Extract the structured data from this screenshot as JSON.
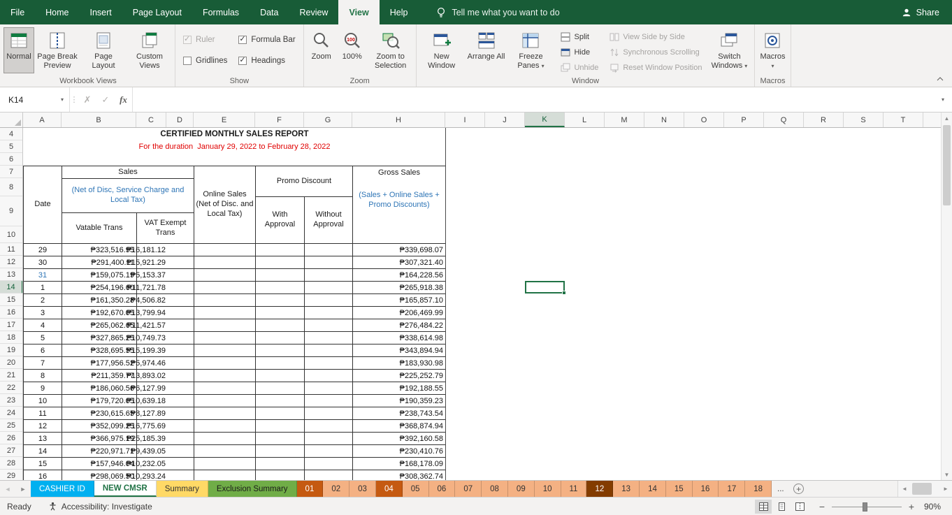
{
  "top_tabs": {
    "items": [
      "File",
      "Home",
      "Insert",
      "Page Layout",
      "Formulas",
      "Data",
      "Review",
      "View",
      "Help"
    ],
    "active": "View",
    "search_label": "Tell me what you want to do",
    "share_label": "Share"
  },
  "ribbon": {
    "workbook_views": {
      "group_label": "Workbook Views",
      "normal": "Normal",
      "page_break_preview": "Page Break Preview",
      "page_layout": "Page Layout",
      "custom_views": "Custom Views",
      "selected": "Normal"
    },
    "show": {
      "group_label": "Show",
      "checkboxes": [
        {
          "label": "Ruler",
          "checked": true,
          "disabled": true
        },
        {
          "label": "Gridlines",
          "checked": false,
          "disabled": false
        },
        {
          "label": "Formula Bar",
          "checked": true,
          "disabled": false
        },
        {
          "label": "Headings",
          "checked": true,
          "disabled": false
        }
      ]
    },
    "zoom": {
      "group_label": "Zoom",
      "zoom": "Zoom",
      "hundred": "100%",
      "zoom_to_selection": "Zoom to Selection"
    },
    "window": {
      "group_label": "Window",
      "large": [
        {
          "label": "New Window"
        },
        {
          "label": "Arrange All"
        },
        {
          "label": "Freeze Panes",
          "dropdown": true
        }
      ],
      "small1": [
        {
          "label": "Split",
          "disabled": false
        },
        {
          "label": "Hide",
          "disabled": false
        },
        {
          "label": "Unhide",
          "disabled": true
        }
      ],
      "small2": [
        {
          "label": "View Side by Side",
          "disabled": true
        },
        {
          "label": "Synchronous Scrolling",
          "disabled": true
        },
        {
          "label": "Reset Window Position",
          "disabled": true
        }
      ],
      "switch_windows": "Switch Windows"
    },
    "macros": {
      "group_label": "Macros",
      "macros": "Macros"
    }
  },
  "formula_bar": {
    "name_box": "K14",
    "fx_label": "fx",
    "formula": ""
  },
  "grid": {
    "columns": [
      "A",
      "B",
      "C",
      "D",
      "E",
      "F",
      "G",
      "H",
      "I",
      "J",
      "K",
      "L",
      "M",
      "N",
      "O",
      "P",
      "Q",
      "R",
      "S",
      "T"
    ],
    "rows": [
      4,
      5,
      6,
      7,
      8,
      9,
      10,
      11,
      12,
      13,
      14,
      15,
      16,
      17,
      18,
      19,
      20,
      21,
      22,
      23,
      24,
      25,
      26,
      27,
      28,
      29
    ],
    "selected_column": "K",
    "selected_row": 14,
    "active_cell": "K14"
  },
  "sheet": {
    "title": "CERTIFIED MONTHLY SALES REPORT",
    "period": "For the duration  January 29, 2022 to February 28, 2022",
    "header": {
      "date": "Date",
      "sales": "Sales",
      "sales_note": "(Net of Disc, Service Charge and Local Tax)",
      "vatable": "Vatable Trans",
      "vat_exempt": "VAT Exempt Trans",
      "online": "Online Sales (Net of Disc. and Local Tax)",
      "promo": "Promo Discount",
      "with_approval": "With Approval",
      "without_approval": "Without Approval",
      "gross": "Gross Sales",
      "gross_note": "(Sales + Online Sales + Promo Discounts)"
    },
    "rows": [
      {
        "row": 11,
        "date": "29",
        "vatable": "₱323,516.95",
        "vat_exempt": "₱16,181.12",
        "gross": "₱339,698.07"
      },
      {
        "row": 12,
        "date": "30",
        "vatable": "₱291,400.11",
        "vat_exempt": "₱15,921.29",
        "gross": "₱307,321.40"
      },
      {
        "row": 13,
        "date": "31",
        "date_style": "blue",
        "vatable": "₱159,075.19",
        "vat_exempt": "₱5,153.37",
        "gross": "₱164,228.56"
      },
      {
        "row": 14,
        "date": "1",
        "vatable": "₱254,196.60",
        "vat_exempt": "₱11,721.78",
        "gross": "₱265,918.38"
      },
      {
        "row": 15,
        "date": "2",
        "vatable": "₱161,350.28",
        "vat_exempt": "₱4,506.82",
        "gross": "₱165,857.10"
      },
      {
        "row": 16,
        "date": "3",
        "vatable": "₱192,670.05",
        "vat_exempt": "₱13,799.94",
        "gross": "₱206,469.99"
      },
      {
        "row": 17,
        "date": "4",
        "vatable": "₱265,062.65",
        "vat_exempt": "₱11,421.57",
        "gross": "₱276,484.22"
      },
      {
        "row": 18,
        "date": "5",
        "vatable": "₱327,865.25",
        "vat_exempt": "₱10,749.73",
        "gross": "₱338,614.98"
      },
      {
        "row": 19,
        "date": "6",
        "vatable": "₱328,695.55",
        "vat_exempt": "₱15,199.39",
        "gross": "₱343,894.94"
      },
      {
        "row": 20,
        "date": "7",
        "vatable": "₱177,956.52",
        "vat_exempt": "₱5,974.46",
        "gross": "₱183,930.98"
      },
      {
        "row": 21,
        "date": "8",
        "vatable": "₱211,359.77",
        "vat_exempt": "₱13,893.02",
        "gross": "₱225,252.79"
      },
      {
        "row": 22,
        "date": "9",
        "vatable": "₱186,060.56",
        "vat_exempt": "₱6,127.99",
        "gross": "₱192,188.55"
      },
      {
        "row": 23,
        "date": "10",
        "vatable": "₱179,720.05",
        "vat_exempt": "₱10,639.18",
        "gross": "₱190,359.23"
      },
      {
        "row": 24,
        "date": "11",
        "vatable": "₱230,615.65",
        "vat_exempt": "₱8,127.89",
        "gross": "₱238,743.54"
      },
      {
        "row": 25,
        "date": "12",
        "vatable": "₱352,099.25",
        "vat_exempt": "₱16,775.69",
        "gross": "₱368,874.94"
      },
      {
        "row": 26,
        "date": "13",
        "vatable": "₱366,975.19",
        "vat_exempt": "₱25,185.39",
        "gross": "₱392,160.58"
      },
      {
        "row": 27,
        "date": "14",
        "vatable": "₱220,971.71",
        "vat_exempt": "₱9,439.05",
        "gross": "₱230,410.76"
      },
      {
        "row": 28,
        "date": "15",
        "vatable": "₱157,946.04",
        "vat_exempt": "₱10,232.05",
        "gross": "₱168,178.09"
      },
      {
        "row": 29,
        "date": "16",
        "vatable": "₱298,069.50",
        "vat_exempt": "₱10,293.24",
        "gross": "₱308,362.74"
      }
    ]
  },
  "sheet_tabs": {
    "active": "NEW CMSR",
    "overflow_label": "...",
    "tabs": [
      {
        "label": "CASHIER ID",
        "bg": "#00B0F0",
        "fg": "#FFFFFF"
      },
      {
        "label": "NEW CMSR",
        "bg": "#FFFFFF",
        "fg": "#217346",
        "active": true
      },
      {
        "label": "Summary",
        "bg": "#FFD966",
        "fg": "#333333"
      },
      {
        "label": "Exclusion Summary",
        "bg": "#70AD47",
        "fg": "#1A1A1A"
      },
      {
        "label": "01",
        "bg": "#C55A11",
        "fg": "#FFFFFF"
      },
      {
        "label": "02",
        "bg": "#F4B183",
        "fg": "#333333"
      },
      {
        "label": "03",
        "bg": "#F4B183",
        "fg": "#333333"
      },
      {
        "label": "04",
        "bg": "#C55A11",
        "fg": "#FFFFFF"
      },
      {
        "label": "05",
        "bg": "#F4B183",
        "fg": "#333333"
      },
      {
        "label": "06",
        "bg": "#F4B183",
        "fg": "#333333"
      },
      {
        "label": "07",
        "bg": "#F4B183",
        "fg": "#333333"
      },
      {
        "label": "08",
        "bg": "#F4B183",
        "fg": "#333333"
      },
      {
        "label": "09",
        "bg": "#F4B183",
        "fg": "#333333"
      },
      {
        "label": "10",
        "bg": "#F4B183",
        "fg": "#333333"
      },
      {
        "label": "11",
        "bg": "#F4B183",
        "fg": "#333333"
      },
      {
        "label": "12",
        "bg": "#833C00",
        "fg": "#FFFFFF"
      },
      {
        "label": "13",
        "bg": "#F4B183",
        "fg": "#333333"
      },
      {
        "label": "14",
        "bg": "#F4B183",
        "fg": "#333333"
      },
      {
        "label": "15",
        "bg": "#F4B183",
        "fg": "#333333"
      },
      {
        "label": "16",
        "bg": "#F4B183",
        "fg": "#333333"
      },
      {
        "label": "17",
        "bg": "#F4B183",
        "fg": "#333333"
      },
      {
        "label": "18",
        "bg": "#F4B183",
        "fg": "#333333"
      }
    ]
  },
  "status_bar": {
    "mode": "Ready",
    "accessibility": "Accessibility: Investigate",
    "zoom_level": "90%"
  },
  "colors": {
    "excel_green": "#185C37",
    "accent_green": "#217346",
    "title_red": "#E00000",
    "note_blue": "#2E75B6",
    "selection_border": "#217346"
  }
}
